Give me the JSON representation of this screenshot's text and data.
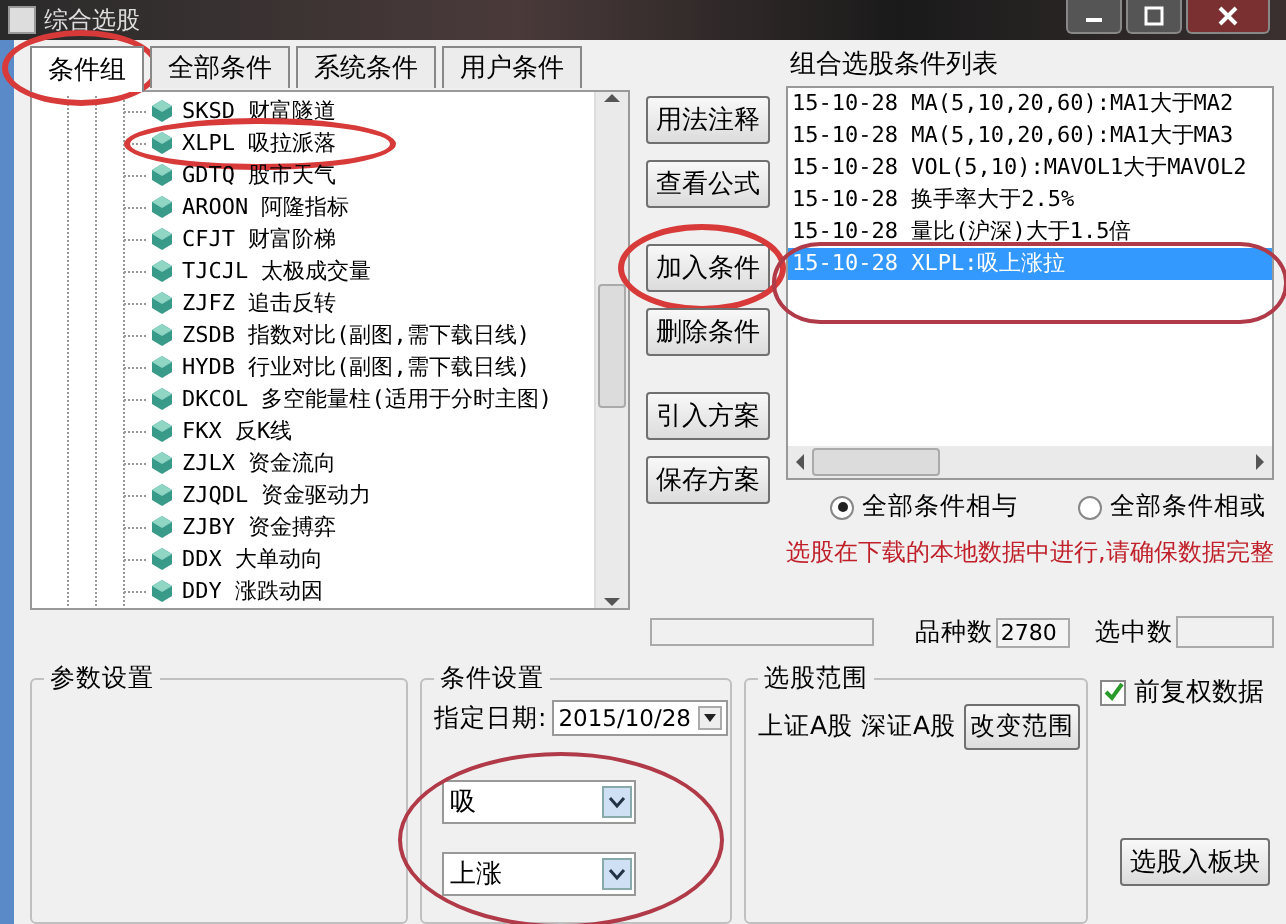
{
  "window": {
    "title": "综合选股"
  },
  "tabs": [
    {
      "label": "条件组",
      "selected": true,
      "circled": true
    },
    {
      "label": "全部条件",
      "selected": false,
      "circled": false
    },
    {
      "label": "系统条件",
      "selected": false,
      "circled": false
    },
    {
      "label": "用户条件",
      "selected": false,
      "circled": false
    }
  ],
  "tree": {
    "items": [
      {
        "code": "SKSD",
        "name": "财富隧道",
        "circled": false
      },
      {
        "code": "XLPL",
        "name": "吸拉派落",
        "circled": true
      },
      {
        "code": "GDTQ",
        "name": "股市天气",
        "circled": false
      },
      {
        "code": "AROON",
        "name": "阿隆指标",
        "circled": false
      },
      {
        "code": "CFJT",
        "name": "财富阶梯",
        "circled": false
      },
      {
        "code": "TJCJL",
        "name": "太极成交量",
        "circled": false
      },
      {
        "code": "ZJFZ",
        "name": "追击反转",
        "circled": false
      },
      {
        "code": "ZSDB",
        "name": "指数对比(副图,需下载日线)",
        "circled": false
      },
      {
        "code": "HYDB",
        "name": "行业对比(副图,需下载日线)",
        "circled": false
      },
      {
        "code": "DKCOL",
        "name": "多空能量柱(适用于分时主图)",
        "circled": false
      },
      {
        "code": "FKX",
        "name": "反K线",
        "circled": false
      },
      {
        "code": "ZJLX",
        "name": "资金流向",
        "circled": false
      },
      {
        "code": "ZJQDL",
        "name": "资金驱动力",
        "circled": false
      },
      {
        "code": "ZJBY",
        "name": "资金搏弈",
        "circled": false
      },
      {
        "code": "DDX",
        "name": "大单动向",
        "circled": false
      },
      {
        "code": "DDY",
        "name": "涨跌动因",
        "circled": false
      }
    ]
  },
  "actions": [
    {
      "label": "用法注释",
      "circled": false
    },
    {
      "label": "查看公式",
      "circled": false
    },
    {
      "label": "加入条件",
      "circled": true
    },
    {
      "label": "删除条件",
      "circled": false
    },
    {
      "label": "引入方案",
      "circled": false
    },
    {
      "label": "保存方案",
      "circled": false
    }
  ],
  "condition_list": {
    "title": "组合选股条件列表",
    "items": [
      {
        "text": "15-10-28 MA(5,10,20,60):MA1大于MA2",
        "selected": false,
        "circled": false
      },
      {
        "text": "15-10-28 MA(5,10,20,60):MA1大于MA3",
        "selected": false,
        "circled": false
      },
      {
        "text": "15-10-28 VOL(5,10):MAVOL1大于MAVOL2",
        "selected": false,
        "circled": false
      },
      {
        "text": "15-10-28 换手率大于2.5%",
        "selected": false,
        "circled": false
      },
      {
        "text": "15-10-28 量比(沪深)大于1.5倍",
        "selected": false,
        "circled": false
      },
      {
        "text": "15-10-28 XLPL:吸上涨拉",
        "selected": true,
        "circled": true
      }
    ]
  },
  "logic": [
    {
      "label": "全部条件相与",
      "selected": true
    },
    {
      "label": "全部条件相或",
      "selected": false
    }
  ],
  "notice": "选股在下载的本地数据中进行,请确保数据完整",
  "counts": {
    "variety_label": "品种数",
    "variety_value": "2780",
    "selected_label": "选中数"
  },
  "param_settings": {
    "title": "参数设置"
  },
  "condition_settings": {
    "title": "条件设置",
    "date_label": "指定日期:",
    "date_value": "2015/10/28",
    "combos": [
      "吸",
      "上涨"
    ],
    "circled": true
  },
  "scope": {
    "title": "选股范围",
    "markets": "上证A股 深证A股",
    "button": "改变范围"
  },
  "adjusted_data": {
    "label": "前复权数据",
    "checked": true
  },
  "to_block_button": "选股入板块"
}
